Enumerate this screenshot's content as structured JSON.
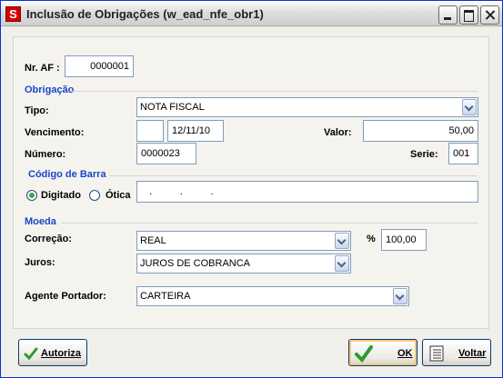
{
  "window": {
    "title": "Inclusão de Obrigações (w_ead_nfe_obr1)",
    "icon_letter": "S"
  },
  "af": {
    "label": "Nr. AF :",
    "value": "0000001"
  },
  "obrigacao": {
    "section": "Obrigação",
    "tipo_label": "Tipo:",
    "tipo_value": "NOTA FISCAL",
    "vencimento_label": "Vencimento:",
    "vencimento_value": "12/11/10",
    "valor_label": "Valor:",
    "valor_value": "50,00",
    "numero_label": "Número:",
    "numero_value": "0000023",
    "serie_label": "Serie:",
    "serie_value": "001"
  },
  "codigo_barra": {
    "section": "Código de Barra",
    "digitado_label": "Digitado",
    "otica_label": "Ótica",
    "selected": "Digitado",
    "value": "   .          .          ."
  },
  "moeda": {
    "section": "Moeda",
    "correcao_label": "Correção:",
    "correcao_value": "REAL",
    "percent_label": "%",
    "percent_value": "100,00",
    "juros_label": "Juros:",
    "juros_value": "JUROS DE COBRANCA"
  },
  "agente": {
    "label": "Agente Portador:",
    "value": "CARTEIRA"
  },
  "buttons": {
    "autoriza": "Autoriza",
    "ok": "OK",
    "voltar": "Voltar"
  },
  "colors": {
    "section_blue": "#1c46c8",
    "dialog_bg": "#ece9d8",
    "ok_check": "#2f9a2f"
  }
}
